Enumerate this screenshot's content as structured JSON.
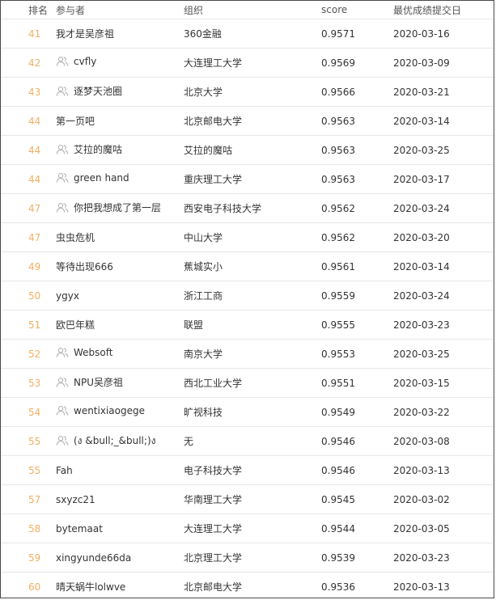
{
  "columns": {
    "rank": "排名",
    "participant": "参与者",
    "organization": "组织",
    "score": "score",
    "best_date": "最优成绩提交日"
  },
  "rows": [
    {
      "rank": "41",
      "team": false,
      "name": "我才是吴彦祖",
      "org": "360金融",
      "score": "0.9571",
      "date": "2020-03-16"
    },
    {
      "rank": "42",
      "team": true,
      "name": "cvfly",
      "org": "大连理工大学",
      "score": "0.9569",
      "date": "2020-03-09"
    },
    {
      "rank": "43",
      "team": true,
      "name": "逐梦天池圈",
      "org": "北京大学",
      "score": "0.9566",
      "date": "2020-03-21"
    },
    {
      "rank": "44",
      "team": false,
      "name": "第一页吧",
      "org": "北京邮电大学",
      "score": "0.9563",
      "date": "2020-03-14"
    },
    {
      "rank": "44",
      "team": true,
      "name": "艾拉的魔咕",
      "org": "艾拉的魔咕",
      "score": "0.9563",
      "date": "2020-03-25"
    },
    {
      "rank": "44",
      "team": true,
      "name": "green hand",
      "org": "重庆理工大学",
      "score": "0.9563",
      "date": "2020-03-17"
    },
    {
      "rank": "47",
      "team": true,
      "name": "你把我想成了第一层",
      "org": "西安电子科技大学",
      "score": "0.9562",
      "date": "2020-03-24"
    },
    {
      "rank": "47",
      "team": false,
      "name": "虫虫危机",
      "org": "中山大学",
      "score": "0.9562",
      "date": "2020-03-20"
    },
    {
      "rank": "49",
      "team": false,
      "name": "等待出现666",
      "org": "蕉城实小",
      "score": "0.9561",
      "date": "2020-03-14"
    },
    {
      "rank": "50",
      "team": false,
      "name": "ygyx",
      "org": "浙江工商",
      "score": "0.9559",
      "date": "2020-03-24"
    },
    {
      "rank": "51",
      "team": false,
      "name": "欧巴年糕",
      "org": "联盟",
      "score": "0.9555",
      "date": "2020-03-23"
    },
    {
      "rank": "52",
      "team": true,
      "name": "Websoft",
      "org": "南京大学",
      "score": "0.9553",
      "date": "2020-03-25"
    },
    {
      "rank": "53",
      "team": true,
      "name": "NPU吴彦祖",
      "org": "西北工业大学",
      "score": "0.9551",
      "date": "2020-03-15"
    },
    {
      "rank": "54",
      "team": true,
      "name": "wentixiaogege",
      "org": "旷视科技",
      "score": "0.9549",
      "date": "2020-03-22"
    },
    {
      "rank": "55",
      "team": true,
      "name": "(ง &bull;_&bull;)ง",
      "org": "无",
      "score": "0.9546",
      "date": "2020-03-08"
    },
    {
      "rank": "55",
      "team": false,
      "name": "Fah",
      "org": "电子科技大学",
      "score": "0.9546",
      "date": "2020-03-13"
    },
    {
      "rank": "57",
      "team": false,
      "name": "sxyzc21",
      "org": "华南理工大学",
      "score": "0.9545",
      "date": "2020-03-02"
    },
    {
      "rank": "58",
      "team": false,
      "name": "bytemaat",
      "org": "大连理工大学",
      "score": "0.9544",
      "date": "2020-03-05"
    },
    {
      "rank": "59",
      "team": false,
      "name": "xingyunde66da",
      "org": "北京理工大学",
      "score": "0.9539",
      "date": "2020-03-23"
    },
    {
      "rank": "60",
      "team": false,
      "name": "晴天蜗牛lolwve",
      "org": "北京邮电大学",
      "score": "0.9536",
      "date": "2020-03-13"
    }
  ],
  "colors": {
    "rank_text": "#f0b063",
    "team_icon": "#b3b3b3",
    "row_divider": "#e8e8e8",
    "frame_border": "#4a4a4a"
  },
  "icons": {
    "team": "team-users-icon"
  }
}
